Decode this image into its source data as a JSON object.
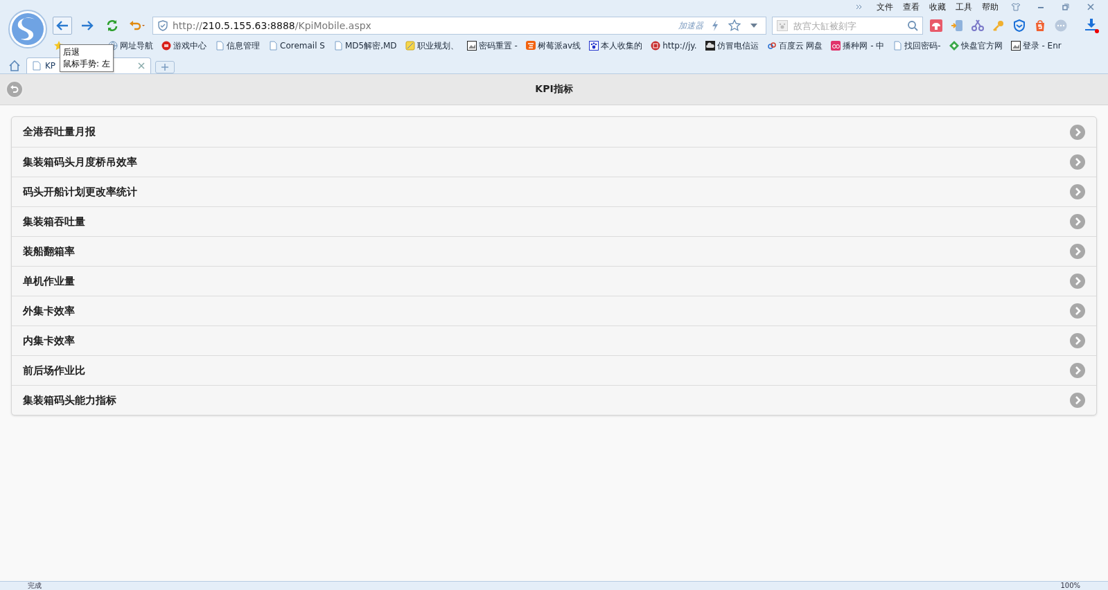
{
  "browser": {
    "menu": [
      "文件",
      "查看",
      "收藏",
      "工具",
      "帮助"
    ],
    "address": {
      "prefix": "http://",
      "host": "210.5.155.63:8888",
      "path": "/KpiMobile.aspx"
    },
    "accelerator": "加速器",
    "search": {
      "placeholder": "故宫大缸被刻字"
    },
    "bookmarks": [
      {
        "kind": "globe",
        "label": "网址导航"
      },
      {
        "kind": "game",
        "label": "游戏中心"
      },
      {
        "kind": "page",
        "label": "信息管理"
      },
      {
        "kind": "page",
        "label": "Coremail S"
      },
      {
        "kind": "page",
        "label": "MD5解密,MD"
      },
      {
        "kind": "note",
        "label": "职业规划、"
      },
      {
        "kind": "image",
        "label": "密码重置 -"
      },
      {
        "kind": "taobao",
        "label": "树莓派av线"
      },
      {
        "kind": "paw",
        "label": "本人收集的"
      },
      {
        "kind": "seal",
        "label": "http://jy."
      },
      {
        "kind": "cloud",
        "label": "仿冒电信运"
      },
      {
        "kind": "link",
        "label": "百度云 网盘"
      },
      {
        "kind": "bo",
        "label": "播种网 - 中"
      },
      {
        "kind": "page",
        "label": "找回密码-"
      },
      {
        "kind": "diamond",
        "label": "快盘官方网"
      },
      {
        "kind": "image",
        "label": "登录 - Enr"
      }
    ],
    "tabs": [
      {
        "title": "KP",
        "selected": true
      }
    ],
    "tooltip": {
      "lines": [
        "后退",
        "鼠标手势: 左"
      ]
    }
  },
  "page": {
    "title": "KPI指标",
    "items": [
      {
        "label": "全港吞吐量月报"
      },
      {
        "label": "集装箱码头月度桥吊效率"
      },
      {
        "label": "码头开船计划更改率统计"
      },
      {
        "label": "集装箱吞吐量"
      },
      {
        "label": "装船翻箱率"
      },
      {
        "label": "单机作业量"
      },
      {
        "label": "外集卡效率"
      },
      {
        "label": "内集卡效率"
      },
      {
        "label": "前后场作业比"
      },
      {
        "label": "集装箱码头能力指标"
      }
    ]
  },
  "status_bar": {
    "text": "完成",
    "zoom": "100%"
  }
}
